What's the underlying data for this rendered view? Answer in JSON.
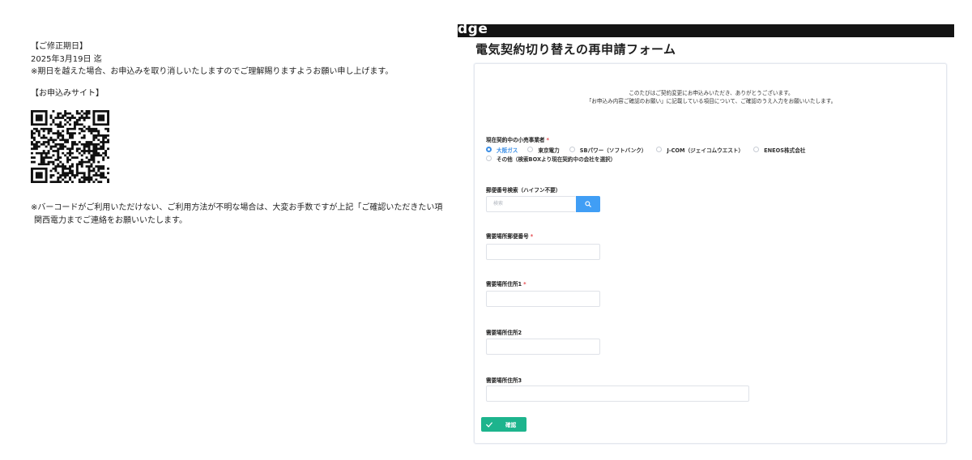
{
  "email": {
    "deadline_heading": "【ご修正期日】",
    "deadline_date": "2025年3月19日 迄",
    "deadline_note": "※期日を越えた場合、お申込みを取り消しいたしますのでご理解賜りますようお願い申し上げます。",
    "site_heading": "【お申込みサイト】",
    "barcode_note_line1": "※バーコードがご利用いただけない、ご利用方法が不明な場合は、大変お手数ですが上記「ご確認いただきたい項",
    "barcode_note_line2": "関西電力までご連絡をお願いいたします。"
  },
  "header": {
    "brand_fragment": "dge",
    "form_title": "電気契約切り替えの再申請フォーム"
  },
  "intro": {
    "line1": "このたびはご契約変更にお申込みいただき、ありがとうございます。",
    "line2": "「お申込み内容ご確認のお願い」に記載している項目について、ご確認のうえ入力をお願いいたします。"
  },
  "fields": {
    "current_provider": {
      "label": "現在契約中の小売事業者",
      "required_mark": "*",
      "options": [
        "大阪ガス",
        "東京電力",
        "SBパワー（ソフトバンク）",
        "J-COM（ジェイコムウエスト）",
        "ENEOS株式会社",
        "その他（検索BOXより現在契約中の会社を選択）"
      ],
      "selected": "大阪ガス"
    },
    "postal_search": {
      "label": "郵便番号検索（ハイフン不要）",
      "placeholder": "検索"
    },
    "postal_code": {
      "label": "需要場所郵便番号",
      "required_mark": "*"
    },
    "address1": {
      "label": "需要場所住所1",
      "required_mark": "*"
    },
    "address2": {
      "label": "需要場所住所2"
    },
    "address3": {
      "label": "需要場所住所3"
    }
  },
  "actions": {
    "confirm_label": "確認"
  },
  "colors": {
    "accent_blue": "#409ef5",
    "confirm_green": "#1db48d",
    "required_red": "#e5484d",
    "topbar": "#141414"
  }
}
